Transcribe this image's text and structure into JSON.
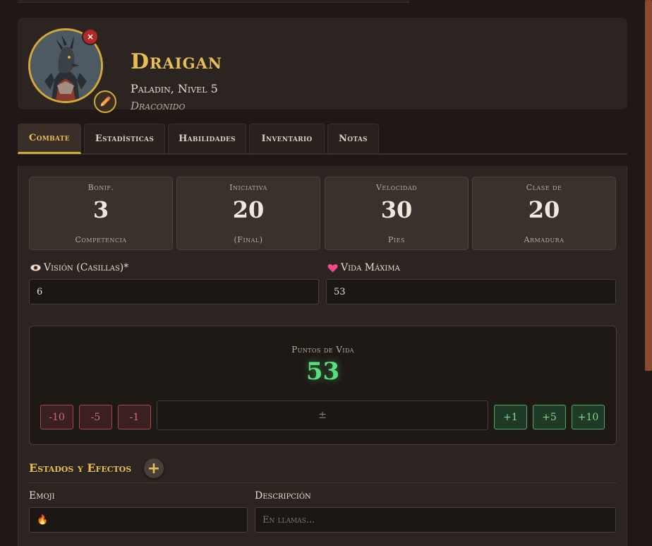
{
  "character": {
    "name": "Draigan",
    "class_level": "Paladin, Nivel 5",
    "race": "Draconido"
  },
  "avatar": {
    "remove_icon": "×",
    "edit_icon": "pencil-icon"
  },
  "tabs": [
    {
      "label": "Combate",
      "active": true
    },
    {
      "label": "Estadísticas",
      "active": false
    },
    {
      "label": "Habilidades",
      "active": false
    },
    {
      "label": "Inventario",
      "active": false
    },
    {
      "label": "Notas",
      "active": false
    }
  ],
  "stats": [
    {
      "top": "Bonif.",
      "value": "3",
      "bottom": "Competencia"
    },
    {
      "top": "Iniciativa",
      "value": "20",
      "bottom": "(Final)"
    },
    {
      "top": "Velocidad",
      "value": "30",
      "bottom": "Pies"
    },
    {
      "top": "Clase de",
      "value": "20",
      "bottom": "Armadura"
    }
  ],
  "fields": {
    "vision_label": "Visión (Casillas)*",
    "vision_value": "6",
    "max_hp_label": "Vida Máxima",
    "max_hp_value": "53"
  },
  "hp": {
    "label": "Puntos de Vida",
    "value": "53",
    "minus_buttons": [
      "-10",
      "-5",
      "-1"
    ],
    "plus_buttons": [
      "+1",
      "+5",
      "+10"
    ],
    "input_placeholder": "±"
  },
  "effects": {
    "title": "Estados y Efectos",
    "add_label": "+",
    "emoji_label": "Emoji",
    "emoji_value": "🔥",
    "description_label": "Descripción",
    "description_placeholder": "En llamas..."
  },
  "colors": {
    "accent_gold": "#e8be52",
    "hp_green": "#58e07a",
    "minus_red": "#d46a6a",
    "plus_green": "#7fd695"
  }
}
